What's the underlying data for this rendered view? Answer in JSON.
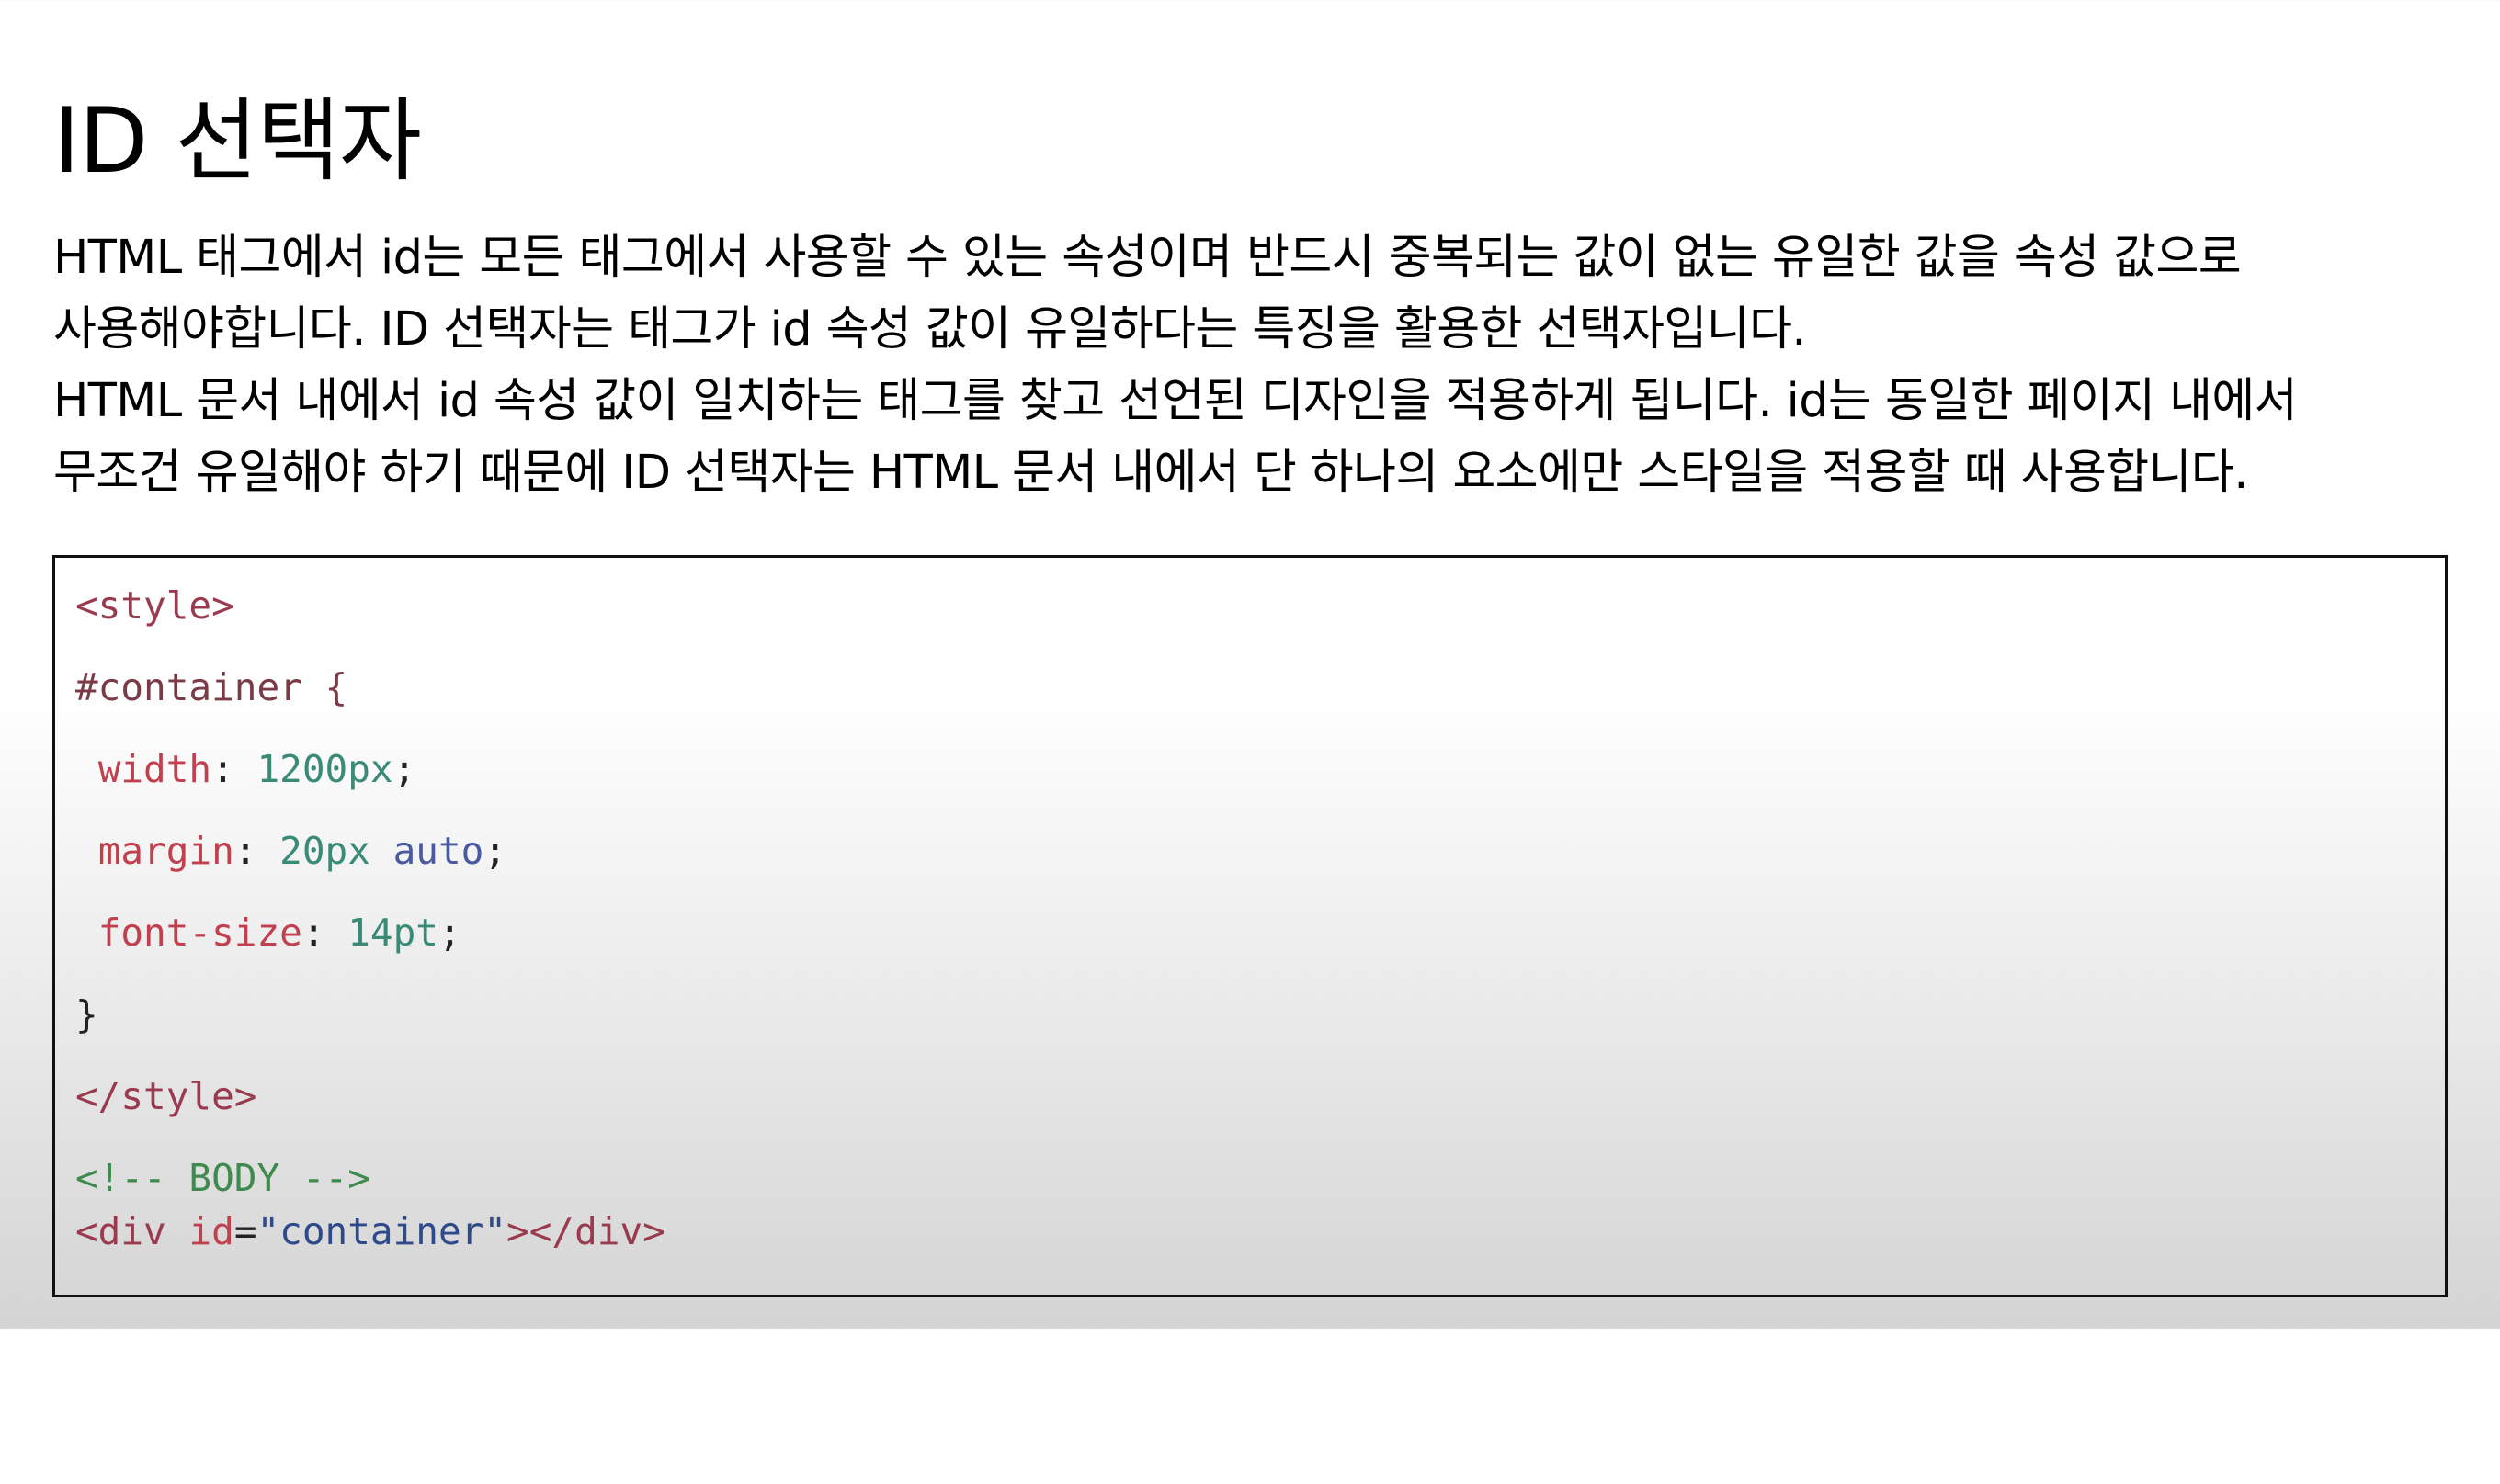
{
  "title": "ID 선택자",
  "paragraph_lines": [
    "HTML 태그에서 id는 모든 태그에서 사용할 수 있는 속성이며 반드시 중복되는 값이 없는 유일한 값을 속성 값으로",
    "사용해야합니다. ID 선택자는 태그가 id 속성 값이 유일하다는 특징을 활용한 선택자입니다.",
    "HTML 문서 내에서 id 속성 값이 일치하는 태그를 찾고 선언된 디자인을 적용하게 됩니다. id는 동일한 페이지 내에서",
    "무조건 유일해야 하기 때문에 ID 선택자는 HTML 문서 내에서 단 하나의 요소에만 스타일을 적용할 때 사용합니다."
  ],
  "code": {
    "style_open": "<style>",
    "selector": "#container {",
    "width_prop": "width",
    "width_value": "1200px",
    "margin_prop": "margin",
    "margin_value_num": "20px",
    "margin_value_kw": "auto",
    "fontsize_prop": "font-size",
    "fontsize_value": "14pt",
    "close_brace": "}",
    "style_close": "</style>",
    "comment": "<!-- BODY -->",
    "div_open": "<div",
    "div_attr": "id",
    "div_eq": "=",
    "div_attr_value": "\"container\"",
    "div_close": "></div>",
    "colon": ":",
    "semicolon": ";"
  },
  "colors": {
    "tag": "#9a3a4e",
    "property": "#c2404e",
    "number": "#3a8a78",
    "keyword": "#4a5aa0",
    "comment": "#3f8a4e",
    "string": "#2e4a8a"
  }
}
